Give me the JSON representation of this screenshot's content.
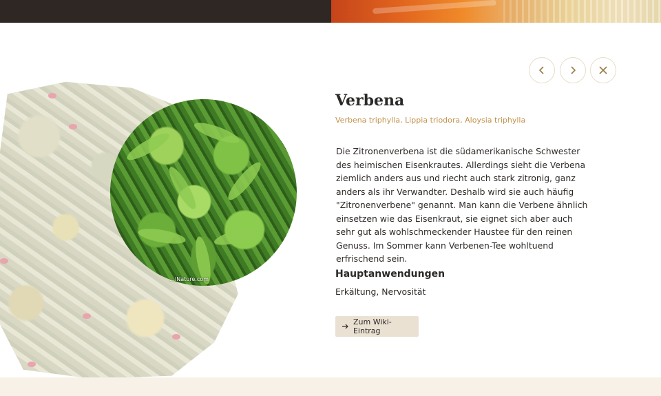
{
  "nav": {
    "prev_icon": "chevron-left-icon",
    "next_icon": "chevron-right-icon",
    "close_icon": "close-icon"
  },
  "herb": {
    "name": "Verbena",
    "latin_names": "Verbena triphylla, Lippia triodora, Aloysia triphylla",
    "description": "Die Zitronenverbena ist die südamerikanische Schwester des heimischen Eisenkrautes. Allerdings sieht die Verbena ziemlich anders aus und riecht auch stark zitronig, ganz anders als ihr Verwandter. Deshalb wird sie auch häufig \"Zitronenverbene\" genannt. Man kann die Verbene ähnlich einsetzen wie das Eisenkraut, sie eignet sich aber auch sehr gut als wohlschmeckender Haustee für den reinen Genuss. Im Sommer kann Verbenen-Tee wohltuend erfrischend sein.",
    "uses_heading": "Hauptanwendungen",
    "uses": "Erkältung, Nervosität",
    "photo_watermark": "…lNature.com"
  },
  "wiki_button": {
    "label": "Zum Wiki-Eintrag",
    "icon": "arrow-right-icon"
  },
  "colors": {
    "accent": "#c2924b",
    "topbar_dark": "#2e2723",
    "button_bg": "#ebe1d2",
    "bottom_band": "#f7f1e8"
  }
}
